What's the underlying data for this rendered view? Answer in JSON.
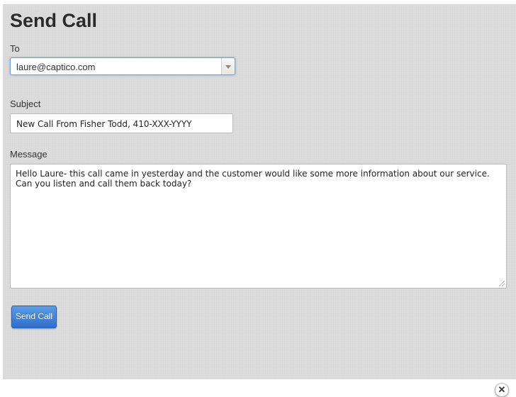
{
  "dialog": {
    "title": "Send Call",
    "to": {
      "label": "To",
      "selected": "laure@captico.com"
    },
    "subject": {
      "label": "Subject",
      "value": "New Call From Fisher Todd, 410-XXX-YYYY"
    },
    "message": {
      "label": "Message",
      "value": "Hello Laure- this call came in yesterday and the customer would like some more information about our service. Can you listen and call them back today?"
    },
    "submit_label": "Send Call",
    "close_glyph": "✕"
  },
  "icons": {
    "dropdown": "chevron-down-icon",
    "close": "close-icon",
    "resize": "resize-handle-icon"
  },
  "colors": {
    "button": "#3a7ed6",
    "focus_border": "#6f9fd8",
    "background": "#dcdcdc"
  }
}
